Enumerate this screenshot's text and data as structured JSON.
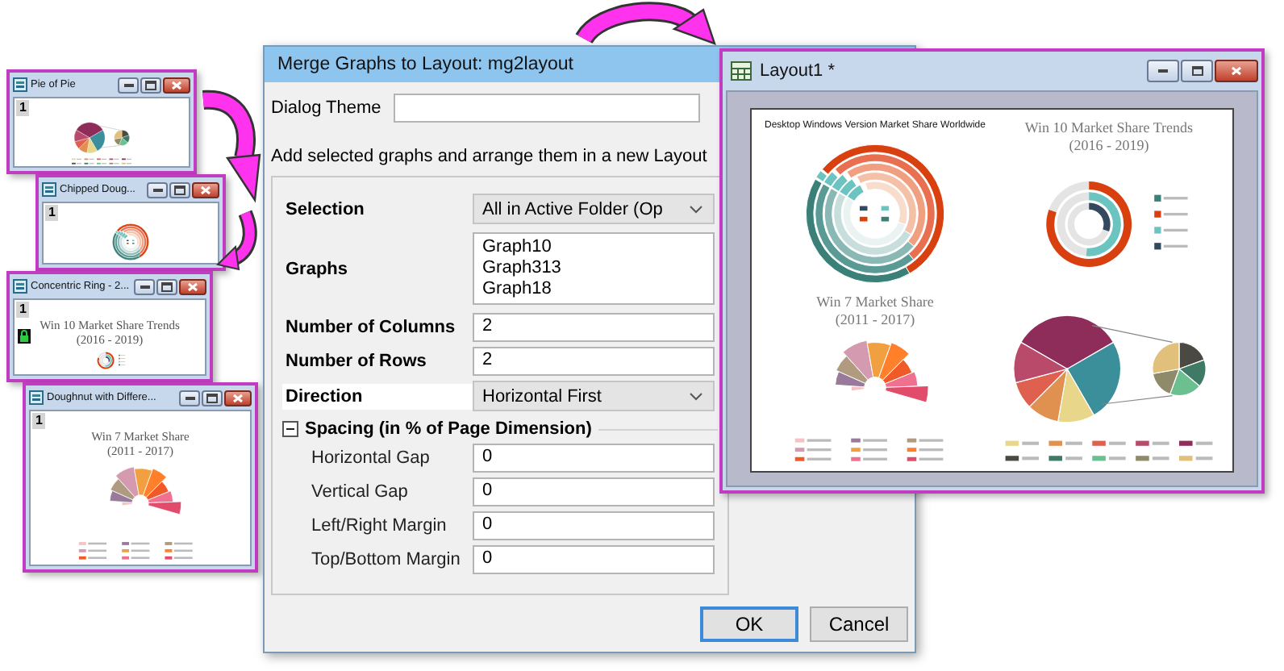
{
  "graph_windows": [
    {
      "title": "Pie of Pie",
      "page": "1",
      "kind": "pie-of-pie",
      "locked": false
    },
    {
      "title": "Chipped Doug...",
      "page": "1",
      "kind": "chipped-doughnut",
      "locked": false
    },
    {
      "title": "Concentric Ring - 2...",
      "page": "1",
      "kind": "concentric-ring",
      "locked": true,
      "chart_title": [
        "Win 10 Market Share Trends",
        "(2016 - 2019)"
      ]
    },
    {
      "title": "Doughnut with Differe...",
      "page": "1",
      "kind": "rose-doughnut",
      "locked": false,
      "chart_title": [
        "Win 7 Market Share",
        "(2011 - 2017)"
      ]
    }
  ],
  "dialog": {
    "title": "Merge Graphs to Layout: mg2layout",
    "theme_label": "Dialog Theme",
    "description": "Add selected graphs and arrange them in a new Layout",
    "fields": [
      {
        "kind": "dropdown",
        "label": "Selection",
        "value": "All in Active Folder (Op",
        "selected": false
      },
      {
        "kind": "list",
        "label": "Graphs",
        "items": [
          "Graph10",
          "Graph313",
          "Graph18"
        ],
        "selected": false
      },
      {
        "kind": "text",
        "label": "Number of Columns",
        "value": "2",
        "selected": false
      },
      {
        "kind": "text",
        "label": "Number of Rows",
        "value": "2",
        "selected": false
      },
      {
        "kind": "dropdown",
        "label": "Direction",
        "value": "Horizontal First",
        "selected": true
      }
    ],
    "spacing": {
      "label": "Spacing (in % of Page Dimension)",
      "expanded": true,
      "fields": [
        {
          "label": "Horizontal Gap",
          "value": "0"
        },
        {
          "label": "Vertical Gap",
          "value": "0"
        },
        {
          "label": "Left/Right Margin",
          "value": "0"
        },
        {
          "label": "Top/Bottom Margin",
          "value": "0"
        }
      ]
    },
    "buttons": [
      {
        "label": "OK",
        "default": true
      },
      {
        "label": "Cancel",
        "default": false
      }
    ]
  },
  "layout_window": {
    "title": "Layout1 *",
    "panels": [
      {
        "kind": "chipped-doughnut",
        "title": [
          "Desktop Windows Version Market Share Worldwide"
        ]
      },
      {
        "kind": "concentric-ring",
        "title": [
          "Win 10 Market Share Trends",
          "(2016 - 2019)"
        ]
      },
      {
        "kind": "rose-doughnut",
        "title": [
          "Win 7 Market Share",
          "(2011 - 2017)"
        ]
      },
      {
        "kind": "pie-of-pie"
      }
    ]
  }
}
